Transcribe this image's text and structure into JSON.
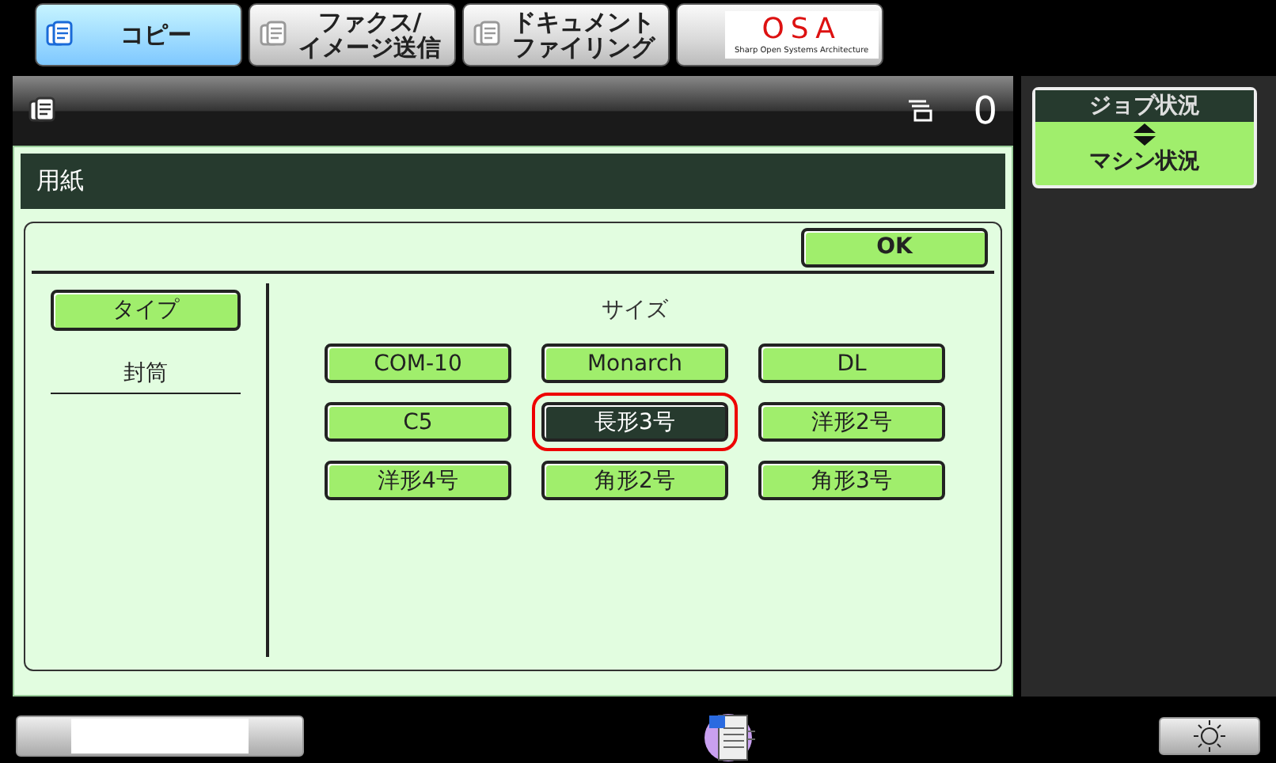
{
  "tabs": [
    {
      "kind": "text",
      "lines": [
        "コピー"
      ],
      "selected": true
    },
    {
      "kind": "text",
      "lines": [
        "ファクス/",
        "イメージ送信"
      ],
      "selected": false
    },
    {
      "kind": "text",
      "lines": [
        "ドキュメント",
        "ファイリング"
      ],
      "selected": false
    },
    {
      "kind": "logo",
      "lines": [
        "OSA",
        "Sharp Open Systems Architecture"
      ],
      "selected": false
    }
  ],
  "header": {
    "job_count": "0"
  },
  "status_toggle": {
    "top": "ジョブ状況",
    "bottom": "マシン状況"
  },
  "panel": {
    "title": "用紙",
    "ok": "OK",
    "type_button": "タイプ",
    "type_value": "封筒",
    "size_heading": "サイズ",
    "sizes": [
      {
        "label": "COM-10",
        "selected": false
      },
      {
        "label": "Monarch",
        "selected": false
      },
      {
        "label": "DL",
        "selected": false
      },
      {
        "label": "C5",
        "selected": false
      },
      {
        "label": "長形3号",
        "selected": true
      },
      {
        "label": "洋形2号",
        "selected": false
      },
      {
        "label": "洋形4号",
        "selected": false
      },
      {
        "label": "角形2号",
        "selected": false
      },
      {
        "label": "角形3号",
        "selected": false
      }
    ]
  }
}
